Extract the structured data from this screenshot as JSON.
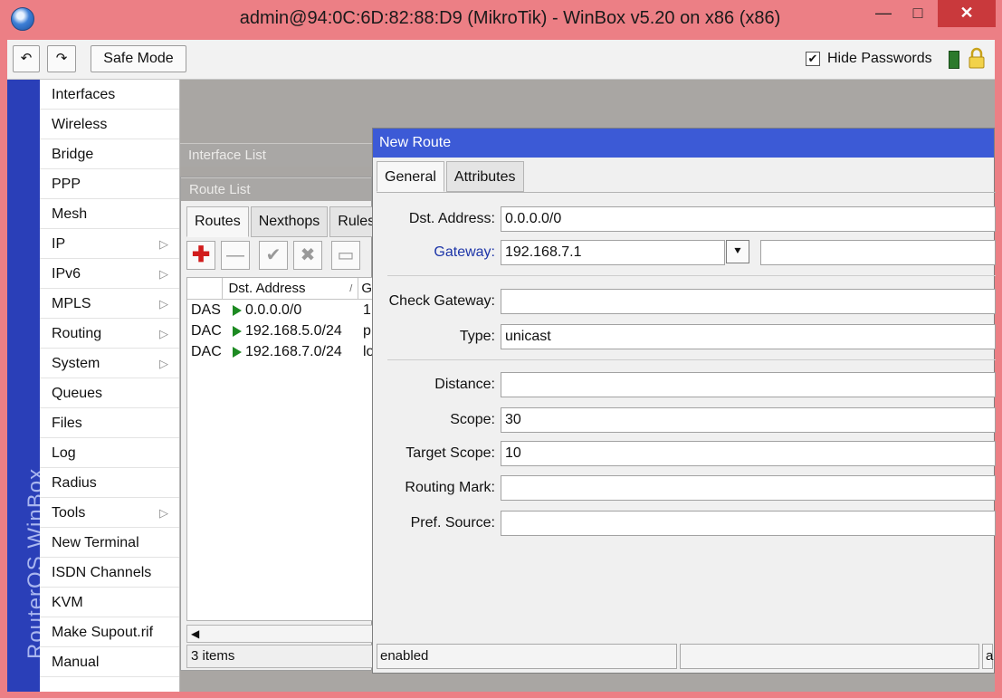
{
  "window": {
    "title": "admin@94:0C:6D:82:88:D9 (MikroTik) - WinBox v5.20 on x86 (x86)",
    "min_label": "—",
    "max_label": "□",
    "close_label": "✕"
  },
  "toolbar": {
    "undo_icon": "undo-icon",
    "undo_glyph": "↶",
    "redo_glyph": "↷",
    "safe_mode_label": "Safe Mode",
    "hide_passwords_label": "Hide Passwords",
    "hide_passwords_checked": true,
    "check_glyph": "✔"
  },
  "brand": {
    "text": "RouterOS WinBox"
  },
  "sidebar": {
    "items": [
      {
        "label": "Interfaces",
        "submenu": false
      },
      {
        "label": "Wireless",
        "submenu": false
      },
      {
        "label": "Bridge",
        "submenu": false
      },
      {
        "label": "PPP",
        "submenu": false
      },
      {
        "label": "Mesh",
        "submenu": false
      },
      {
        "label": "IP",
        "submenu": true
      },
      {
        "label": "IPv6",
        "submenu": true
      },
      {
        "label": "MPLS",
        "submenu": true
      },
      {
        "label": "Routing",
        "submenu": true
      },
      {
        "label": "System",
        "submenu": true
      },
      {
        "label": "Queues",
        "submenu": false
      },
      {
        "label": "Files",
        "submenu": false
      },
      {
        "label": "Log",
        "submenu": false
      },
      {
        "label": "Radius",
        "submenu": false
      },
      {
        "label": "Tools",
        "submenu": true
      },
      {
        "label": "New Terminal",
        "submenu": false
      },
      {
        "label": "ISDN Channels",
        "submenu": false
      },
      {
        "label": "KVM",
        "submenu": false
      },
      {
        "label": "Make Supout.rif",
        "submenu": false
      },
      {
        "label": "Manual",
        "submenu": false
      }
    ],
    "submenu_glyph": "▷"
  },
  "interface_list": {
    "title": "Interface List"
  },
  "route_list": {
    "title": "Route List",
    "tabs": [
      "Routes",
      "Nexthops",
      "Rules"
    ],
    "active_tab": "Routes",
    "columns": [
      "",
      "Dst. Address",
      "G"
    ],
    "sort_glyph": "/",
    "rows": [
      {
        "flags": "DAS",
        "dst": "0.0.0.0/0",
        "gw": "1"
      },
      {
        "flags": "DAC",
        "dst": "192.168.5.0/24",
        "gw": "p"
      },
      {
        "flags": "DAC",
        "dst": "192.168.7.0/24",
        "gw": "lo"
      }
    ],
    "toolbar_glyphs": {
      "add": "✚",
      "remove": "—",
      "enable": "✔",
      "disable": "✖",
      "comment": "▭"
    },
    "status": "3 items"
  },
  "new_route": {
    "title": "New Route",
    "tabs": [
      "General",
      "Attributes"
    ],
    "active_tab": "General",
    "fields": {
      "dst_address": {
        "label": "Dst. Address:",
        "value": "0.0.0.0/0"
      },
      "gateway": {
        "label": "Gateway:",
        "value": "192.168.7.1",
        "extra": ""
      },
      "check_gateway": {
        "label": "Check Gateway:",
        "value": ""
      },
      "type": {
        "label": "Type:",
        "value": "unicast"
      },
      "distance": {
        "label": "Distance:",
        "value": ""
      },
      "scope": {
        "label": "Scope:",
        "value": "30"
      },
      "target_scope": {
        "label": "Target Scope:",
        "value": "10"
      },
      "routing_mark": {
        "label": "Routing Mark:",
        "value": ""
      },
      "pref_source": {
        "label": "Pref. Source:",
        "value": ""
      }
    },
    "dropdown_glyph": "⯆",
    "status": [
      "enabled",
      "",
      "a"
    ]
  },
  "colors": {
    "frame": "#ec7f85",
    "brand_bar": "#2a3fb8",
    "dialog_title": "#3c5ad6",
    "close_button": "#c9393c",
    "gateway_label": "#1d35a8",
    "flag_green": "#1d8a22"
  }
}
